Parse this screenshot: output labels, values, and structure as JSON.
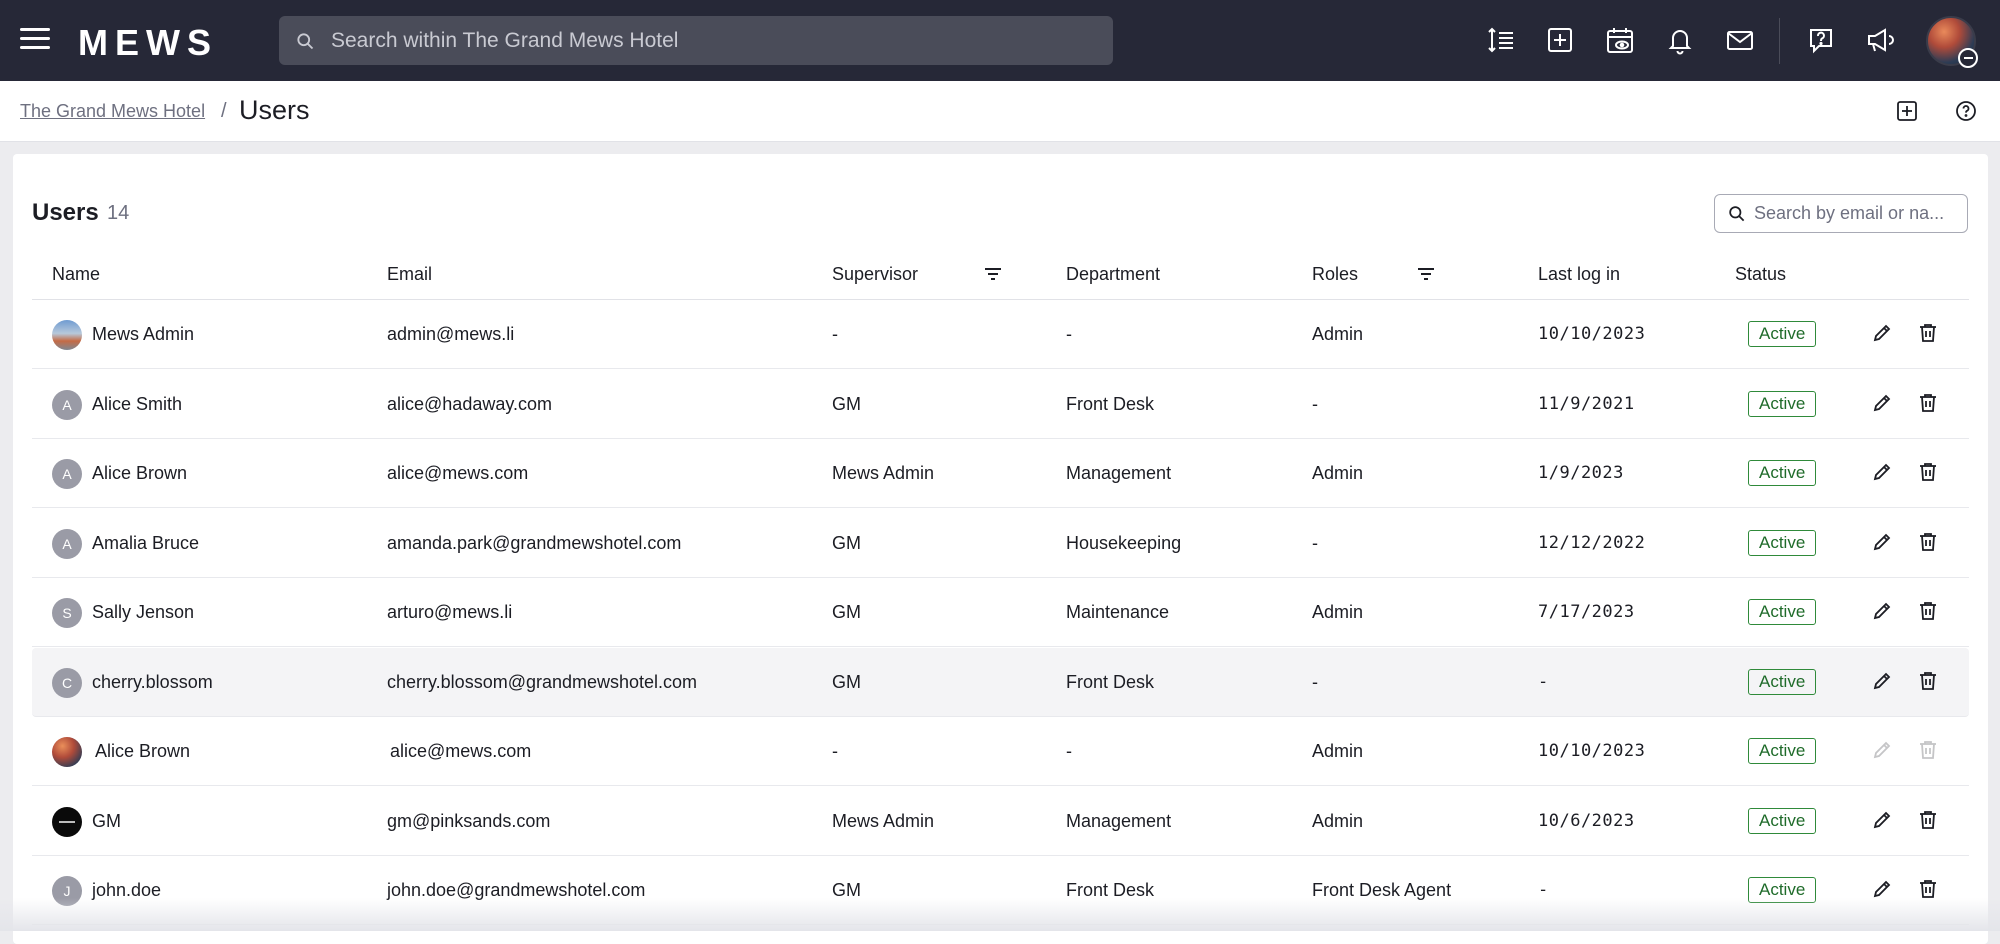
{
  "topbar": {
    "logo": "MEWS",
    "search_placeholder": "Search within The Grand Mews Hotel",
    "icons": [
      "hamburger-menu-icon",
      "sort-lines-icon",
      "add-square-icon",
      "calendar-eye-icon",
      "bell-icon",
      "mail-icon",
      "help-square-icon",
      "megaphone-icon",
      "user-avatar"
    ]
  },
  "breadcrumb": {
    "parent": "The Grand Mews Hotel",
    "separator": "/",
    "current": "Users"
  },
  "table": {
    "title": "Users",
    "count": "14",
    "search_placeholder": "Search by email or na...",
    "columns": {
      "name": "Name",
      "email": "Email",
      "supervisor": "Supervisor",
      "department": "Department",
      "roles": "Roles",
      "last_login": "Last log in",
      "status": "Status"
    },
    "rows": [
      {
        "avatar": "",
        "name": "Mews Admin",
        "email": "admin@mews.li",
        "supervisor": "-",
        "department": "-",
        "roles": "Admin",
        "last_login": "10/10/2023",
        "status": "Active"
      },
      {
        "avatar": "A",
        "name": "Alice Smith",
        "email": "alice@hadaway.com",
        "supervisor": "GM",
        "department": "Front Desk",
        "roles": "-",
        "last_login": "11/9/2021",
        "status": "Active"
      },
      {
        "avatar": "A",
        "name": "Alice Brown",
        "email": "alice@mews.com",
        "supervisor": "Mews Admin",
        "department": "Management",
        "roles": "Admin",
        "last_login": "1/9/2023",
        "status": "Active"
      },
      {
        "avatar": "A",
        "name": "Amalia Bruce",
        "email": "amanda.park@grandmewshotel.com",
        "supervisor": "GM",
        "department": "Housekeeping",
        "roles": "-",
        "last_login": "12/12/2022",
        "status": "Active"
      },
      {
        "avatar": "S",
        "name": "Sally Jenson",
        "email": "arturo@mews.li",
        "supervisor": "GM",
        "department": "Maintenance",
        "roles": "Admin",
        "last_login": "7/17/2023",
        "status": "Active"
      },
      {
        "avatar": "C",
        "name": "cherry.blossom",
        "email": "cherry.blossom@grandmewshotel.com",
        "supervisor": "GM",
        "department": "Front Desk",
        "roles": "-",
        "last_login": "-",
        "status": "Active"
      },
      {
        "avatar": "",
        "name": "Alice Brown",
        "email": "alice@mews.com",
        "supervisor": "-",
        "department": "-",
        "roles": "Admin",
        "last_login": "10/10/2023",
        "status": "Active"
      },
      {
        "avatar": "",
        "name": "GM",
        "email": "gm@pinksands.com",
        "supervisor": "Mews Admin",
        "department": "Management",
        "roles": "Admin",
        "last_login": "10/6/2023",
        "status": "Active"
      },
      {
        "avatar": "J",
        "name": "john.doe",
        "email": "john.doe@grandmewshotel.com",
        "supervisor": "GM",
        "department": "Front Desk",
        "roles": "Front Desk Agent",
        "last_login": "-",
        "status": "Active"
      }
    ]
  },
  "colors": {
    "topbar_bg": "#262837",
    "search_bg": "#4a4c59",
    "status_green": "#2f8a3a",
    "row_highlight": "#f4f4f6"
  }
}
